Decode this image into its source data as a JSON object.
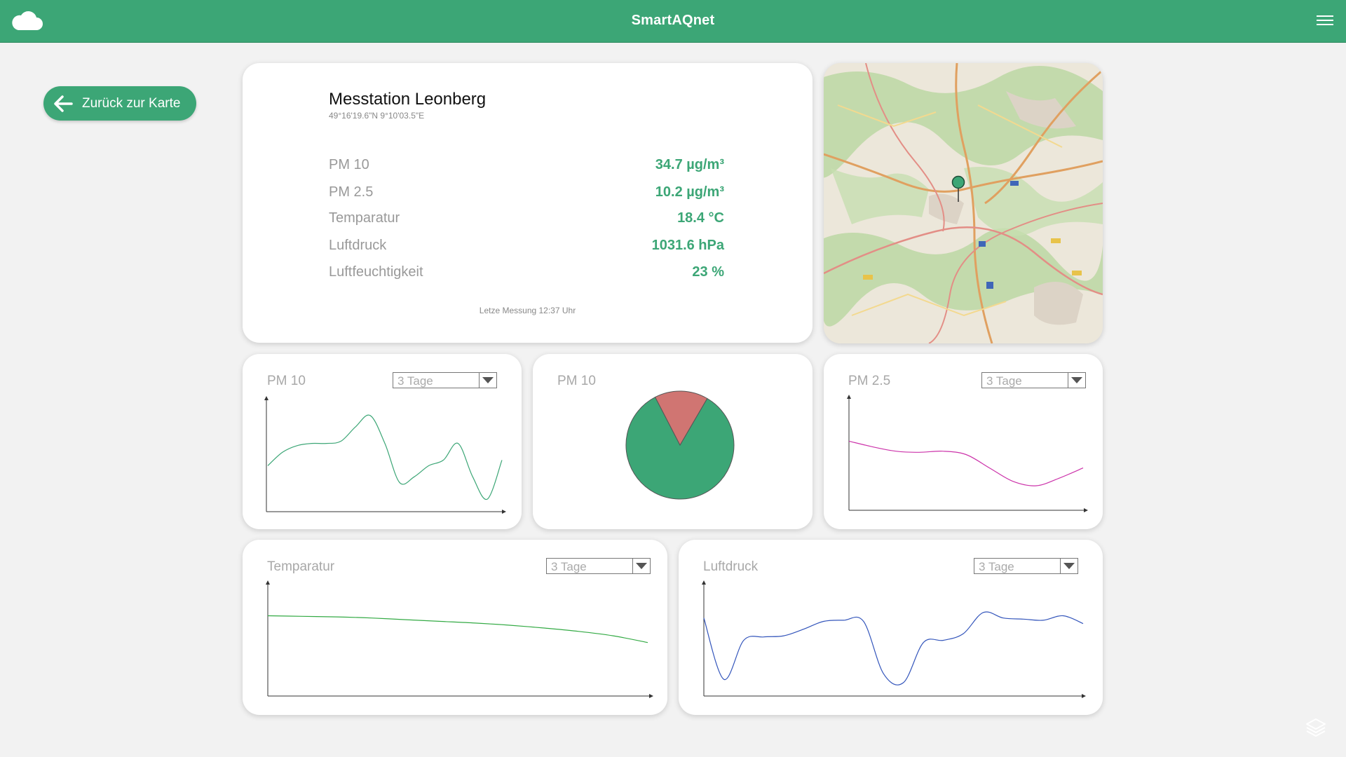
{
  "app": {
    "title": "SmartAQnet"
  },
  "header": {
    "logo_icon": "cloud-icon",
    "menu_icon": "hamburger-menu-icon"
  },
  "back_button": {
    "label": "Zurück zur Karte",
    "icon": "arrow-left-icon"
  },
  "station": {
    "name": "Messtation Leonberg",
    "coords": "49°16'19.6\"N 9°10'03.5\"E",
    "measurements": [
      {
        "label": "PM 10",
        "value": "34.7 µg/m³"
      },
      {
        "label": "PM 2.5",
        "value": "10.2 µg/m³"
      },
      {
        "label": "Temparatur",
        "value": "18.4 °C"
      },
      {
        "label": "Luftdruck",
        "value": "1031.6 hPa"
      },
      {
        "label": "Luftfeuchtigkeit",
        "value": "23 %"
      }
    ],
    "last_measurement": "Letze Messung 12:37 Uhr"
  },
  "charts": {
    "pm10_line": {
      "title": "PM 10",
      "range": "3 Tage"
    },
    "pm10_pie": {
      "title": "PM 10"
    },
    "pm25_line": {
      "title": "PM 2.5",
      "range": "3 Tage"
    },
    "temp_line": {
      "title": "Temparatur",
      "range": "3 Tage"
    },
    "pressure_line": {
      "title": "Luftdruck",
      "range": "3 Tage"
    }
  },
  "chart_data": [
    {
      "type": "line",
      "series": [
        {
          "values": [
            40,
            52,
            58,
            60,
            60,
            62,
            75,
            85,
            60,
            25,
            30,
            40,
            45,
            60,
            30,
            10,
            45
          ],
          "color": "#3ca676"
        }
      ],
      "ylim": [
        0,
        100
      ]
    },
    {
      "type": "pie",
      "values": [
        84,
        16
      ],
      "colors": [
        "#3ca676",
        "#d07572"
      ]
    },
    {
      "type": "line",
      "series": [
        {
          "values": [
            62,
            57,
            53,
            52,
            53,
            50,
            38,
            26,
            22,
            29,
            38
          ],
          "color": "#cc33aa"
        }
      ],
      "ylim": [
        0,
        100
      ]
    },
    {
      "type": "line",
      "series": [
        {
          "values": [
            72,
            71.5,
            71,
            70,
            68.5,
            67,
            65.5,
            63.5,
            61,
            58,
            54,
            48
          ],
          "color": "#33aa44"
        }
      ],
      "ylim": [
        0,
        100
      ]
    },
    {
      "type": "line",
      "series": [
        {
          "values": [
            70,
            15,
            50,
            53,
            54,
            60,
            67,
            68,
            67,
            20,
            12,
            48,
            50,
            56,
            75,
            70,
            69,
            68,
            72,
            65
          ],
          "color": "#3355bb"
        }
      ],
      "ylim": [
        0,
        100
      ]
    }
  ],
  "map": {
    "marker_color": "#3ca676"
  }
}
